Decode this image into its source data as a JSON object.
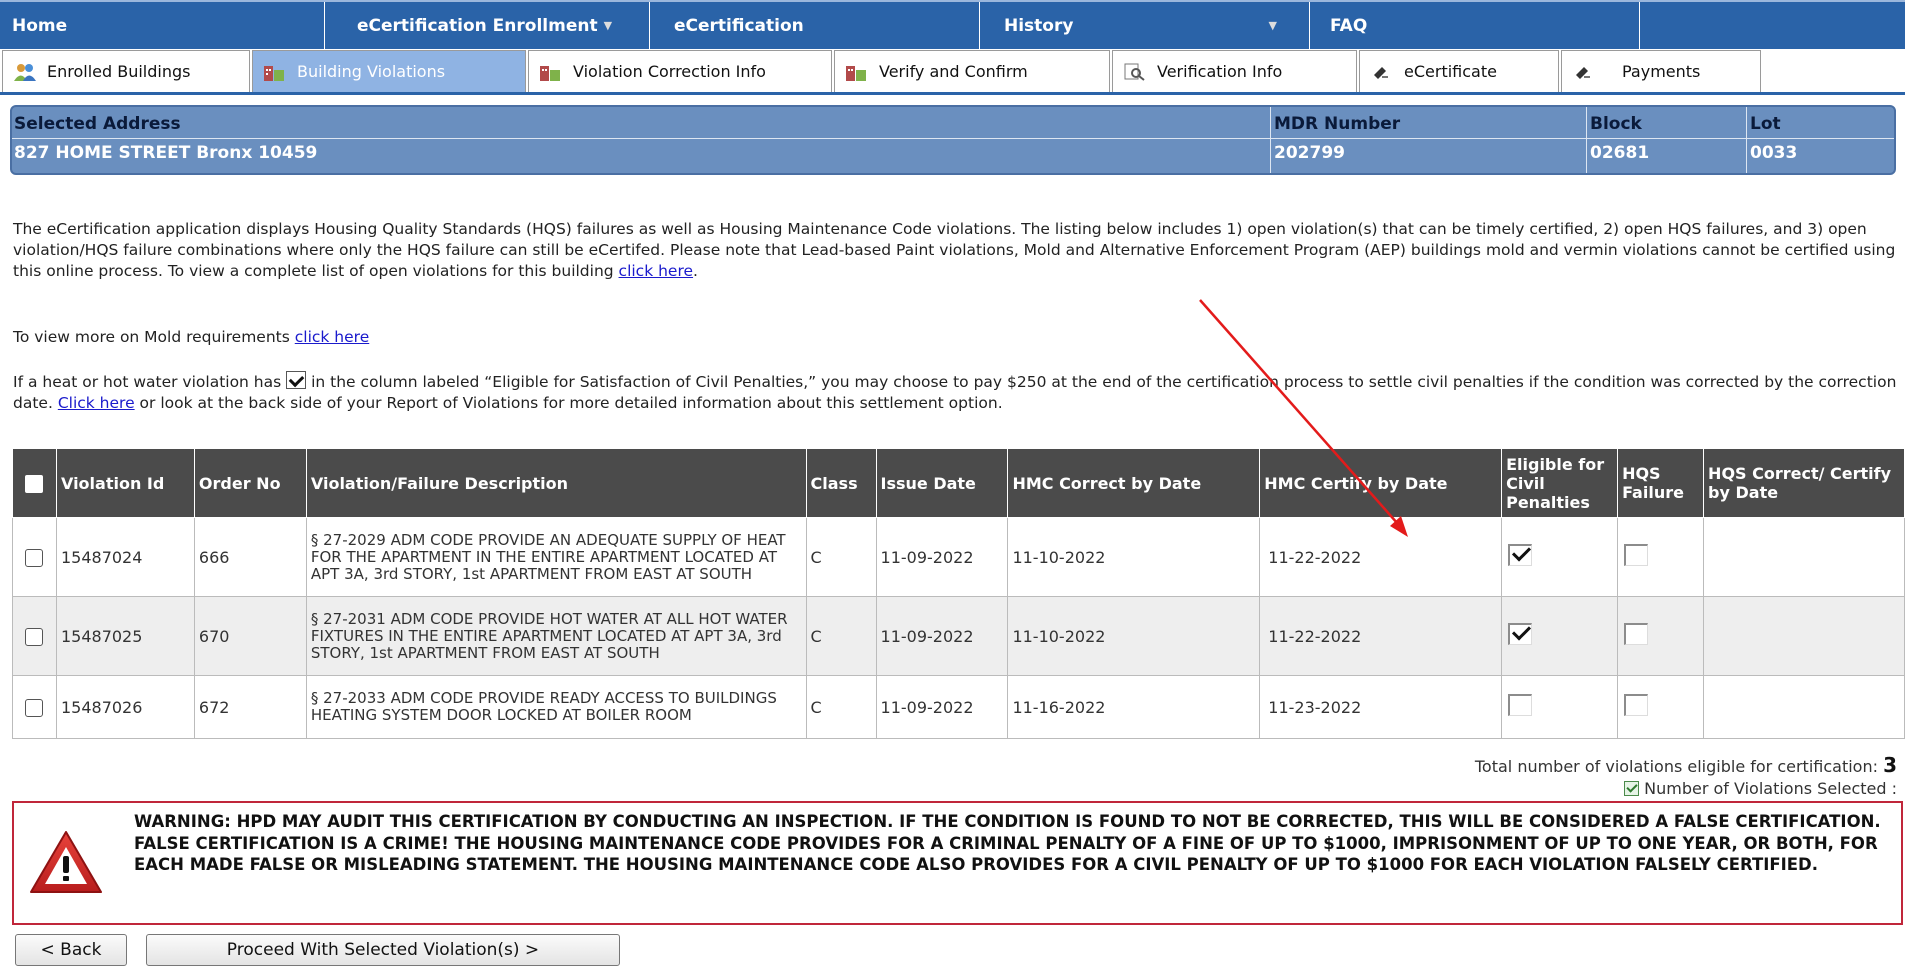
{
  "nav": {
    "items": [
      {
        "label": "Home",
        "caret": false
      },
      {
        "label": "eCertification Enrollment",
        "caret": true
      },
      {
        "label": "eCertification",
        "caret": false
      },
      {
        "label": "History",
        "caret": true
      },
      {
        "label": "FAQ",
        "caret": false
      }
    ]
  },
  "tabs": [
    {
      "label": "Enrolled Buildings",
      "icon": "users-icon",
      "active": false
    },
    {
      "label": "Building Violations",
      "icon": "building-icon",
      "active": true
    },
    {
      "label": "Violation Correction Info",
      "icon": "building-icon",
      "active": false
    },
    {
      "label": "Verify and Confirm",
      "icon": "building-icon",
      "active": false
    },
    {
      "label": "Verification Info",
      "icon": "magnifier-icon",
      "active": false
    },
    {
      "label": "eCertificate",
      "icon": "stamp-icon",
      "active": false
    },
    {
      "label": "Payments",
      "icon": "stamp-icon",
      "active": false
    }
  ],
  "address": {
    "selected_address_label": "Selected Address",
    "selected_address": "827 HOME STREET Bronx 10459",
    "mdr_label": "MDR Number",
    "mdr": "202799",
    "block_label": "Block",
    "block": "02681",
    "lot_label": "Lot",
    "lot": "0033"
  },
  "intro": {
    "text": "The eCertification application displays Housing Quality Standards (HQS) failures as well as Housing Maintenance Code violations. The listing below includes 1) open violation(s) that can be timely certified, 2) open HQS failures, and 3) open violation/HQS failure combinations where only the HQS failure can still be eCertifed. Please note that Lead-based Paint violations, Mold and Alternative Enforcement Program (AEP) buildings mold and vermin violations cannot be certified using this online process. To view a complete list of open violations for this building ",
    "link": "click here",
    "end": "."
  },
  "mold": {
    "text": "To view more on Mold requirements ",
    "link": "click here"
  },
  "heat": {
    "text1": "If a heat or hot water violation has ",
    "text2": " in the column labeled “Eligible for Satisfaction of Civil Penalties,” you may choose to pay $250 at the end of the certification process to settle civil penalties if the condition was corrected by the correction date. ",
    "link": "Click here",
    "text3": " or look at the back side of your Report of Violations for more detailed information about this settlement option."
  },
  "table": {
    "headers": {
      "violation_id": "Violation Id",
      "order_no": "Order No",
      "description": "Violation/Failure Description",
      "class": "Class",
      "issue_date": "Issue Date",
      "hmc_correct": "HMC Correct by Date",
      "hmc_certify": "HMC Certify by Date",
      "eligible": "Eligible for Civil Penalties",
      "hqs_failure": "HQS Failure",
      "hqs_correct": "HQS Correct/ Certify by Date"
    },
    "rows": [
      {
        "violation_id": "15487024",
        "order_no": "666",
        "description": "§ 27-2029 ADM CODE PROVIDE AN ADEQUATE SUPPLY OF HEAT FOR THE APARTMENT IN THE ENTIRE APARTMENT LOCATED AT APT 3A, 3rd STORY, 1st APARTMENT FROM EAST AT SOUTH",
        "class": "C",
        "issue_date": "11-09-2022",
        "hmc_correct": "11-10-2022",
        "hmc_certify": "11-22-2022",
        "eligible": true,
        "hqs_failure": false,
        "hqs_correct": ""
      },
      {
        "violation_id": "15487025",
        "order_no": "670",
        "description": "§ 27-2031 ADM CODE PROVIDE HOT WATER AT ALL HOT WATER FIXTURES IN THE ENTIRE APARTMENT LOCATED AT APT 3A, 3rd STORY, 1st APARTMENT FROM EAST AT SOUTH",
        "class": "C",
        "issue_date": "11-09-2022",
        "hmc_correct": "11-10-2022",
        "hmc_certify": "11-22-2022",
        "eligible": true,
        "hqs_failure": false,
        "hqs_correct": ""
      },
      {
        "violation_id": "15487026",
        "order_no": "672",
        "description": "§ 27-2033 ADM CODE PROVIDE READY ACCESS TO BUILDINGS HEATING SYSTEM DOOR LOCKED AT BOILER ROOM",
        "class": "C",
        "issue_date": "11-09-2022",
        "hmc_correct": "11-16-2022",
        "hmc_certify": "11-23-2022",
        "eligible": false,
        "hqs_failure": false,
        "hqs_correct": ""
      }
    ]
  },
  "totals": {
    "eligible_label": "Total number of violations eligible for certification: ",
    "eligible_count": "3",
    "selected_label": "Number of Violations Selected :"
  },
  "warning": {
    "text": "WARNING: HPD MAY AUDIT THIS CERTIFICATION BY CONDUCTING AN INSPECTION. IF THE CONDITION IS FOUND TO NOT BE CORRECTED, THIS WILL BE CONSIDERED A FALSE CERTIFICATION. FALSE CERTIFICATION IS A CRIME! THE HOUSING MAINTENANCE CODE PROVIDES FOR A CRIMINAL PENALTY OF A FINE OF UP TO $1000, IMPRISONMENT OF UP TO ONE YEAR, OR BOTH, FOR EACH MADE FALSE OR MISLEADING STATEMENT. THE HOUSING MAINTENANCE CODE ALSO PROVIDES FOR A CIVIL PENALTY OF UP TO $1000 FOR EACH VIOLATION FALSELY CERTIFIED."
  },
  "buttons": {
    "back": "< Back",
    "proceed": "Proceed With Selected Violation(s) >"
  },
  "colors": {
    "nav": "#2a63a8",
    "header": "#4b4b4b",
    "warning_border": "#c0263a",
    "annotation_arrow": "#e31b1b"
  }
}
